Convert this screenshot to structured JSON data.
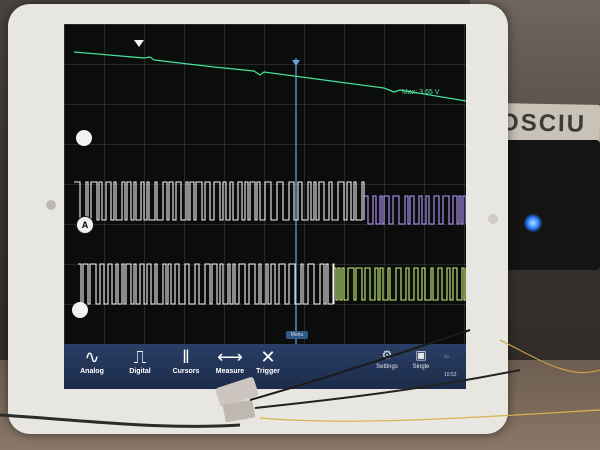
{
  "background": {
    "label_text": "OSCIU"
  },
  "screen": {
    "max_label": "Max: 3.65 V",
    "menu_tab": "Menu",
    "toolbar": {
      "tools": [
        {
          "icon": "sine-wave-icon",
          "glyph": "∿",
          "label": "Analog"
        },
        {
          "icon": "square-pulse-icon",
          "glyph": "⎍",
          "label": "Digital"
        },
        {
          "icon": "cursor-bars-icon",
          "glyph": "‖",
          "label": "Cursors"
        },
        {
          "icon": "measure-icon",
          "glyph": "⟷",
          "label": "Measure"
        },
        {
          "icon": "trigger-icon",
          "glyph": "✕",
          "label": "Trigger"
        }
      ],
      "right_tools": [
        {
          "icon": "settings-icon",
          "glyph": "⚙",
          "label": "Settings"
        },
        {
          "icon": "single-icon",
          "glyph": "▣",
          "label": "Single"
        }
      ],
      "clock": "10:52"
    }
  },
  "colors": {
    "green_trace": "#45e09a",
    "purple_trace": "#b79bff",
    "yellow_trace": "#c9f07b",
    "white_trace": "#f2f2f2",
    "toolbar": "#1c2c4a"
  }
}
